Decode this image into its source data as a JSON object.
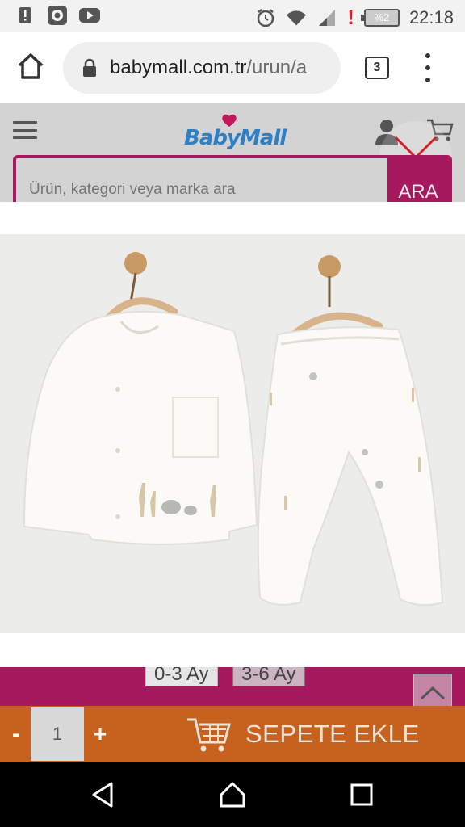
{
  "status_bar": {
    "battery_percent": "%2",
    "time": "22:18",
    "icons": [
      "alert-icon",
      "app-icon",
      "youtube-icon",
      "alarm-icon",
      "wifi-icon",
      "signal-icon",
      "battery-alert-icon",
      "battery-icon"
    ]
  },
  "browser": {
    "url_domain": "babymall.com.tr",
    "url_path": "/urun/a",
    "tab_count": "3",
    "icons": [
      "home-icon",
      "lock-icon",
      "tabs-icon",
      "overflow-menu-icon"
    ]
  },
  "site_header": {
    "logo_text_part1": "Baby",
    "logo_text_part2": "Mall",
    "search_placeholder": "Ürün, kategori veya marka ara",
    "search_button": "ARA",
    "icons": [
      "hamburger-icon",
      "user-icon",
      "cart-icon",
      "close-icon"
    ]
  },
  "product": {
    "sizes": [
      {
        "label": "0-3 Ay",
        "selected": false
      },
      {
        "label": "3-6 Ay",
        "selected": true
      }
    ]
  },
  "cart_bar": {
    "minus_label": "-",
    "quantity": "1",
    "plus_label": "+",
    "add_to_cart_label": "SEPETE EKLE",
    "icons": [
      "shopping-cart-icon",
      "chevron-up-icon"
    ]
  },
  "colors": {
    "brand_magenta": "#a7195e",
    "cart_orange": "#c7611e",
    "logo_blue": "#2f7fc5"
  },
  "navigation": {
    "icons": [
      "back-icon",
      "home-icon",
      "recents-icon"
    ]
  }
}
